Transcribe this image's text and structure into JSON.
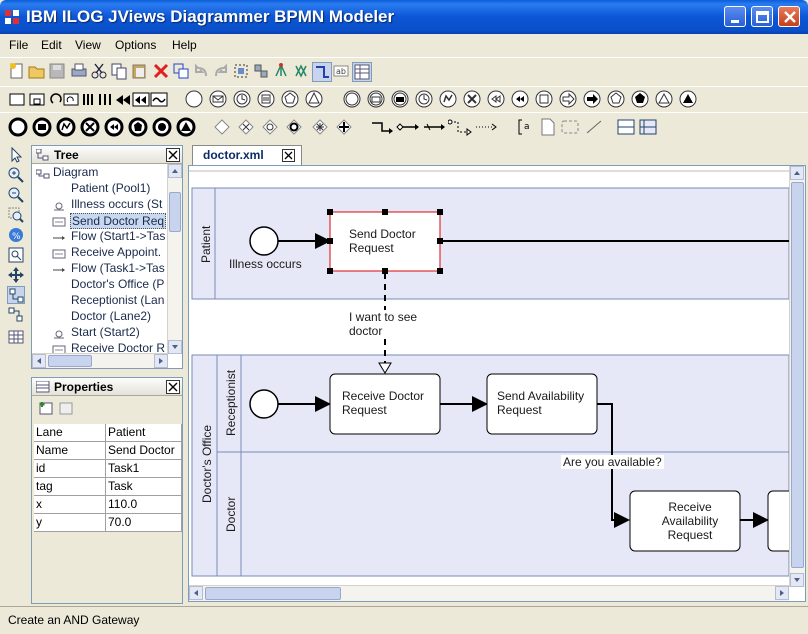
{
  "window": {
    "title": "IBM ILOG JViews Diagrammer BPMN Modeler"
  },
  "menu": [
    "File",
    "Edit",
    "View",
    "Options",
    "Help"
  ],
  "tree": {
    "title": "Tree",
    "items": [
      {
        "label": "Diagram",
        "icon": "diagram-icon"
      },
      {
        "label": "Patient (Pool1)",
        "icon": "none"
      },
      {
        "label": "Illness occurs (St",
        "icon": "start-event-icon"
      },
      {
        "label": "Send Doctor Req",
        "icon": "task-icon",
        "selected": true
      },
      {
        "label": "Flow (Start1->Tas",
        "icon": "flow-icon"
      },
      {
        "label": "Receive Appoint.",
        "icon": "task-icon"
      },
      {
        "label": "Flow (Task1->Tas",
        "icon": "flow-icon"
      },
      {
        "label": "Doctor's Office (P",
        "icon": "none"
      },
      {
        "label": "Receptionist (Lan",
        "icon": "none"
      },
      {
        "label": "Doctor (Lane2)",
        "icon": "none"
      },
      {
        "label": "Start (Start2)",
        "icon": "start-event-icon"
      },
      {
        "label": "Receive Doctor R",
        "icon": "task-icon"
      }
    ]
  },
  "properties": {
    "title": "Properties",
    "rows": [
      {
        "key": "Lane",
        "value": "Patient"
      },
      {
        "key": "Name",
        "value": "Send Doctor"
      },
      {
        "key": "id",
        "value": "Task1"
      },
      {
        "key": "tag",
        "value": "Task"
      },
      {
        "key": "x",
        "value": "110.0"
      },
      {
        "key": "y",
        "value": "70.0"
      }
    ]
  },
  "editor": {
    "tab_label": "doctor.xml"
  },
  "diagram": {
    "pools": [
      {
        "label": "Patient"
      },
      {
        "label": "Doctor's Office"
      }
    ],
    "lanes": [
      {
        "label": "Receptionist"
      },
      {
        "label": "Doctor"
      }
    ],
    "start_event_label": "Illness occurs",
    "tasks": {
      "send_doctor_request": "Send Doctor Request",
      "receive_doctor_request": "Receive Doctor Request",
      "send_availability_request": "Send Availability Request",
      "receive_availability_request": "Receive Availability Request"
    },
    "message_label": "I want to see doctor",
    "flow_label": "Are you available?"
  },
  "status": {
    "text": "Create an AND Gateway"
  },
  "colors": {
    "pool_fill": "#e6e8f8",
    "lane_divider": "#7a8ab8",
    "selection": "#e03030",
    "title_bar": "#0a5ed8"
  }
}
